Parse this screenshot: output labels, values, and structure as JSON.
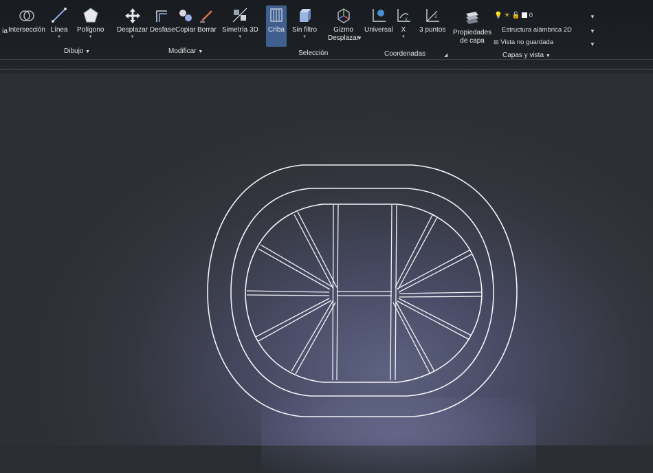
{
  "toolbar": {
    "draw": {
      "interseccion_partial": "ia",
      "interseccion": "Intersección",
      "linea": "Línea",
      "poligono": "Polígono",
      "panel": "Dibujo"
    },
    "modify": {
      "desplazar": "Desplazar",
      "desfase": "Desfase",
      "copiar": "Copiar",
      "borrar": "Borrar",
      "simetria": "Simetría 3D",
      "panel": "Modificar"
    },
    "selection": {
      "criba": "Criba",
      "sin_filtro": "Sin filtro",
      "gizmo_line1": "Gizmo",
      "gizmo_line2": "Desplazar",
      "panel": "Selección"
    },
    "coords": {
      "universal": "Universal",
      "x": "X",
      "tres_puntos": "3 puntos",
      "panel": "Coordenadas"
    },
    "layers": {
      "propiedades_line1": "Propiedades",
      "propiedades_line2": "de capa",
      "layer_value": "0",
      "visual_style": "Estructura alámbrica 2D",
      "view": "Vista no guardada",
      "panel": "Capas y vista"
    }
  },
  "colors": {
    "ribbon_bg": "#1b1e22",
    "active_tool": "#3f5f8f",
    "drawing_lines": "#f2f2f7"
  }
}
